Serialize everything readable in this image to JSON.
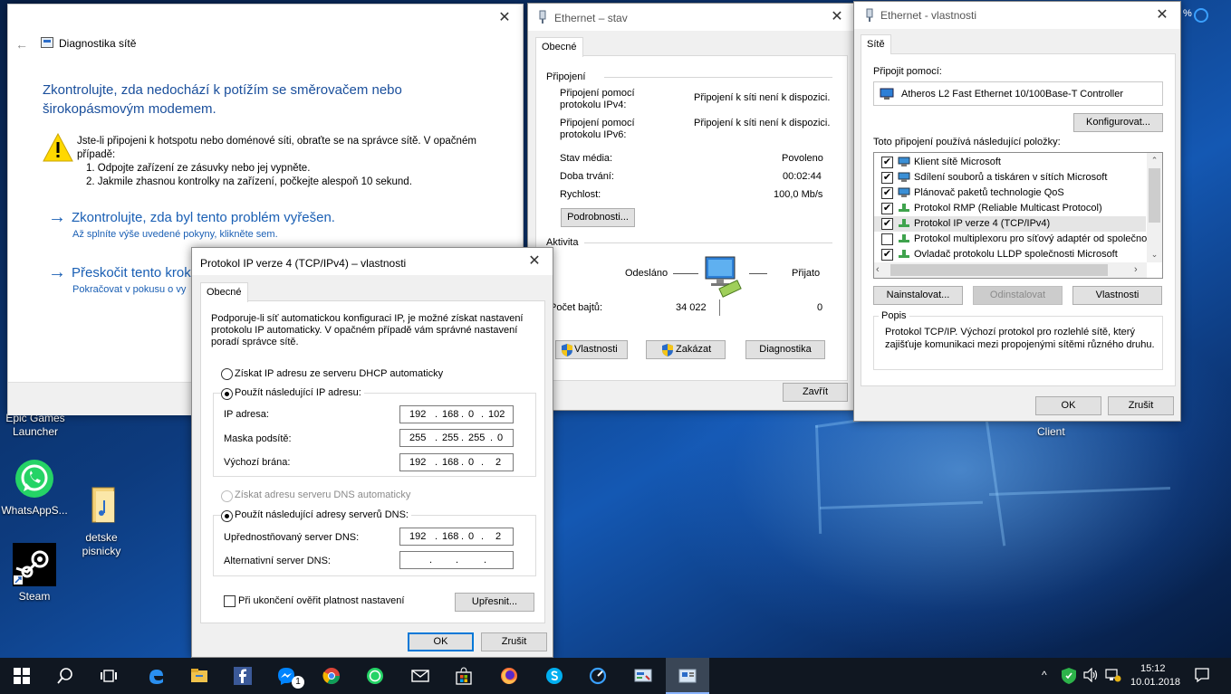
{
  "desktop": {
    "icons": [
      {
        "name": "epic-games",
        "label": "Epic Games\nLauncher"
      },
      {
        "name": "whatsapp",
        "label": "WhatsAppS..."
      },
      {
        "name": "detske-pisnicky",
        "label": "detske\npisnicky"
      },
      {
        "name": "steam",
        "label": "Steam"
      }
    ],
    "partial_label_client": "Client"
  },
  "diagnostics": {
    "title": "Diagnostika sítě",
    "heading": "Zkontrolujte, zda nedochází k potížím se směrovačem nebo širokopásmovým modemem.",
    "warning_text": "Jste-li připojeni k hotspotu nebo doménové síti, obraťte se na správce sítě. V opačném případě:",
    "step1": "1. Odpojte zařízení ze zásuvky nebo jej vypněte.",
    "step2": "2. Jakmile zhasnou kontrolky na zařízení, počkejte alespoň 10 sekund.",
    "option1_title": "Zkontrolujte, zda byl tento problém vyřešen.",
    "option1_sub": "Až splníte výše uvedené pokyny, klikněte sem.",
    "option2_title": "Přeskočit tento krok",
    "option2_sub": "Pokračovat v pokusu o vy"
  },
  "eth_status": {
    "title": "Ethernet – stav",
    "tab": "Obecné",
    "section_connection": "Připojení",
    "ipv4_label": "Připojení pomocí\nprotokolu IPv4:",
    "ipv4_value": "Připojení k síti není k dispozici.",
    "ipv6_label": "Připojení pomocí\nprotokolu IPv6:",
    "ipv6_value": "Připojení k síti není k dispozici.",
    "media_label": "Stav média:",
    "media_value": "Povoleno",
    "duration_label": "Doba trvání:",
    "duration_value": "00:02:44",
    "speed_label": "Rychlost:",
    "speed_value": "100,0 Mb/s",
    "details_btn": "Podrobnosti...",
    "section_activity": "Aktivita",
    "sent_label": "Odesláno",
    "received_label": "Přijato",
    "bytes_label": "Počet bajtů:",
    "bytes_sent": "34 022",
    "bytes_received": "0",
    "properties_btn": "Vlastnosti",
    "disable_btn": "Zakázat",
    "diagnose_btn": "Diagnostika",
    "close_btn": "Zavřít"
  },
  "eth_props": {
    "title": "Ethernet - vlastnosti",
    "tab": "Sítě",
    "connect_using_label": "Připojit pomocí:",
    "adapter": "Atheros L2 Fast Ethernet 10/100Base-T Controller",
    "configure_btn": "Konfigurovat...",
    "items_label": "Toto připojení používá následující položky:",
    "items": [
      {
        "label": "Klient sítě Microsoft",
        "checked": "✔"
      },
      {
        "label": "Sdílení souborů a tiskáren v sítích Microsoft",
        "checked": "✔"
      },
      {
        "label": "Plánovač paketů technologie QoS",
        "checked": "✔"
      },
      {
        "label": "Protokol RMP (Reliable Multicast Protocol)",
        "checked": "✔"
      },
      {
        "label": "Protokol IP verze 4 (TCP/IPv4)",
        "checked": "✔"
      },
      {
        "label": "Protokol multiplexoru pro síťový adaptér od společnosti",
        "checked": ""
      },
      {
        "label": "Ovladač protokolu LLDP společnosti Microsoft",
        "checked": "✔"
      }
    ],
    "install_btn": "Nainstalovat...",
    "uninstall_btn": "Odinstalovat",
    "properties_btn": "Vlastnosti",
    "description_label": "Popis",
    "description": "Protokol TCP/IP. Výchozí protokol pro rozlehlé sítě, který zajišťuje komunikaci mezi propojenými sítěmi různého druhu.",
    "ok_btn": "OK",
    "cancel_btn": "Zrušit"
  },
  "ipv4": {
    "title": "Protokol IP verze 4 (TCP/IPv4) – vlastnosti",
    "tab": "Obecné",
    "intro": "Podporuje-li síť automatickou konfiguraci IP, je možné získat nastavení protokolu IP automaticky. V opačném případě vám správné nastavení poradí správce sítě.",
    "auto_ip": "Získat IP adresu ze serveru DHCP automaticky",
    "manual_ip": "Použít následující IP adresu:",
    "ip_label": "IP adresa:",
    "ip": [
      "192",
      "168",
      "0",
      "102"
    ],
    "mask_label": "Maska podsítě:",
    "mask": [
      "255",
      "255",
      "255",
      "0"
    ],
    "gateway_label": "Výchozí brána:",
    "gateway": [
      "192",
      "168",
      "0",
      "2"
    ],
    "auto_dns": "Získat adresu serveru DNS automaticky",
    "manual_dns": "Použít následující adresy serverů DNS:",
    "dns1_label": "Upřednostňovaný server DNS:",
    "dns1": [
      "192",
      "168",
      "0",
      "2"
    ],
    "dns2_label": "Alternativní server DNS:",
    "dns2": [
      "",
      "",
      "",
      ""
    ],
    "validate_label": "Při ukončení ověřit platnost nastavení",
    "advanced_btn": "Upřesnit...",
    "ok_btn": "OK",
    "cancel_btn": "Zrušit"
  },
  "taskbar": {
    "messenger_badge": "1",
    "time": "15:12",
    "date": "10.01.2018"
  }
}
